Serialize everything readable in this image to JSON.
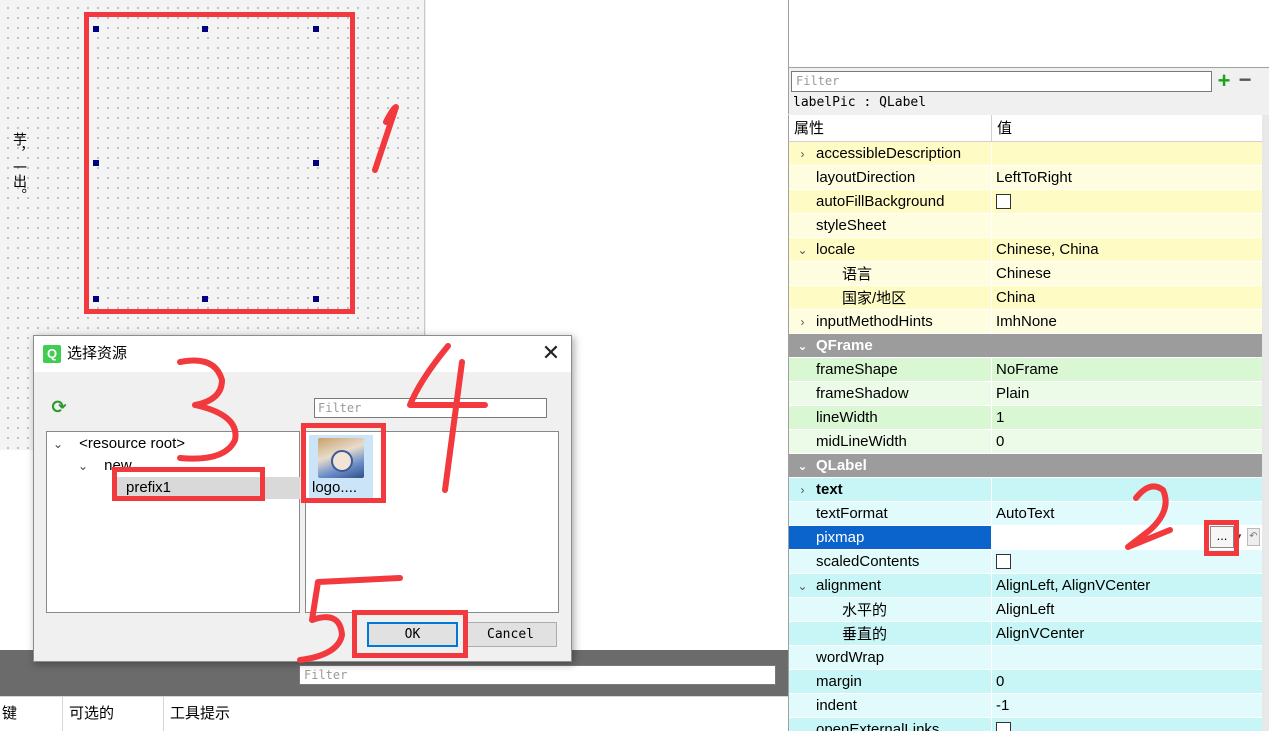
{
  "canvas": {
    "edge_text": "芋，一出。"
  },
  "dialog": {
    "title": "选择资源",
    "close_glyph": "✕",
    "icon_glyph": "Q",
    "reload_glyph": "⟳",
    "filter_placeholder": "Filter",
    "tree": {
      "root": "<resource root>",
      "child": "new",
      "grandchild": "prefix1"
    },
    "file": {
      "label": "logo...."
    },
    "ok_label": "OK",
    "cancel_label": "Cancel"
  },
  "bottom": {
    "filter_placeholder": "Filter",
    "columns": [
      "键",
      "可选的",
      "工具提示"
    ]
  },
  "properties": {
    "filter_placeholder": "Filter",
    "add_glyph": "+",
    "remove_glyph": "−",
    "object_name": "labelPic : QLabel",
    "header_property": "属性",
    "header_value": "值",
    "pixmap_button": "...",
    "rows": [
      {
        "name": "accessibleDescription",
        "value": "",
        "arrow": "›",
        "indent": false,
        "kind": "normal",
        "group": "QWidget",
        "bold": false
      },
      {
        "name": "layoutDirection",
        "value": "LeftToRight",
        "arrow": "",
        "indent": false,
        "kind": "normal",
        "group": "QWidget",
        "bold": false
      },
      {
        "name": "autoFillBackground",
        "value": "",
        "arrow": "",
        "indent": false,
        "kind": "checkbox",
        "group": "QWidget",
        "bold": false
      },
      {
        "name": "styleSheet",
        "value": "",
        "arrow": "",
        "indent": false,
        "kind": "normal",
        "group": "QWidget",
        "bold": false
      },
      {
        "name": "locale",
        "value": "Chinese, China",
        "arrow": "⌄",
        "indent": false,
        "kind": "normal",
        "group": "QWidget",
        "bold": false
      },
      {
        "name": "语言",
        "value": "Chinese",
        "arrow": "",
        "indent": true,
        "kind": "normal",
        "group": "QWidget",
        "bold": false
      },
      {
        "name": "国家/地区",
        "value": "China",
        "arrow": "",
        "indent": true,
        "kind": "normal",
        "group": "QWidget",
        "bold": false
      },
      {
        "name": "inputMethodHints",
        "value": "ImhNone",
        "arrow": "›",
        "indent": false,
        "kind": "normal",
        "group": "QWidget",
        "bold": false
      },
      {
        "name": "QFrame",
        "value": "",
        "arrow": "⌄",
        "indent": false,
        "kind": "section",
        "group": "",
        "bold": true
      },
      {
        "name": "frameShape",
        "value": "NoFrame",
        "arrow": "",
        "indent": false,
        "kind": "normal",
        "group": "QFrame",
        "bold": false
      },
      {
        "name": "frameShadow",
        "value": "Plain",
        "arrow": "",
        "indent": false,
        "kind": "normal",
        "group": "QFrame",
        "bold": false
      },
      {
        "name": "lineWidth",
        "value": "1",
        "arrow": "",
        "indent": false,
        "kind": "normal",
        "group": "QFrame",
        "bold": false
      },
      {
        "name": "midLineWidth",
        "value": "0",
        "arrow": "",
        "indent": false,
        "kind": "normal",
        "group": "QFrame",
        "bold": false
      },
      {
        "name": "QLabel",
        "value": "",
        "arrow": "⌄",
        "indent": false,
        "kind": "section",
        "group": "",
        "bold": true
      },
      {
        "name": "text",
        "value": "",
        "arrow": "›",
        "indent": false,
        "kind": "normal",
        "group": "QLabel",
        "bold": true
      },
      {
        "name": "textFormat",
        "value": "AutoText",
        "arrow": "",
        "indent": false,
        "kind": "normal",
        "group": "QLabel",
        "bold": false
      },
      {
        "name": "pixmap",
        "value": "",
        "arrow": "",
        "indent": false,
        "kind": "selected",
        "group": "QLabel",
        "bold": false
      },
      {
        "name": "scaledContents",
        "value": "",
        "arrow": "",
        "indent": false,
        "kind": "checkbox",
        "group": "QLabel",
        "bold": false
      },
      {
        "name": "alignment",
        "value": "AlignLeft, AlignVCenter",
        "arrow": "⌄",
        "indent": false,
        "kind": "normal",
        "group": "QLabel",
        "bold": false
      },
      {
        "name": "水平的",
        "value": "AlignLeft",
        "arrow": "",
        "indent": true,
        "kind": "normal",
        "group": "QLabel",
        "bold": false
      },
      {
        "name": "垂直的",
        "value": "AlignVCenter",
        "arrow": "",
        "indent": true,
        "kind": "normal",
        "group": "QLabel",
        "bold": false
      },
      {
        "name": "wordWrap",
        "value": "",
        "arrow": "",
        "indent": false,
        "kind": "normal",
        "group": "QLabel",
        "bold": false
      },
      {
        "name": "margin",
        "value": "0",
        "arrow": "",
        "indent": false,
        "kind": "normal",
        "group": "QLabel",
        "bold": false
      },
      {
        "name": "indent",
        "value": "-1",
        "arrow": "",
        "indent": false,
        "kind": "normal",
        "group": "QLabel",
        "bold": false
      },
      {
        "name": "openExternalLinks",
        "value": "",
        "arrow": "",
        "indent": false,
        "kind": "checkbox",
        "group": "QLabel",
        "bold": false
      }
    ]
  },
  "group_colors": {
    "QWidget": [
      "#fffbc5",
      "#fffde0"
    ],
    "QFrame": [
      "#d8f7d2",
      "#ecfbe8"
    ],
    "QLabel": [
      "#c8f6f7",
      "#e1fbfc"
    ]
  },
  "annotations": {
    "color": "#f2393d",
    "numbers": [
      "1",
      "2",
      "3",
      "4",
      "5"
    ]
  }
}
